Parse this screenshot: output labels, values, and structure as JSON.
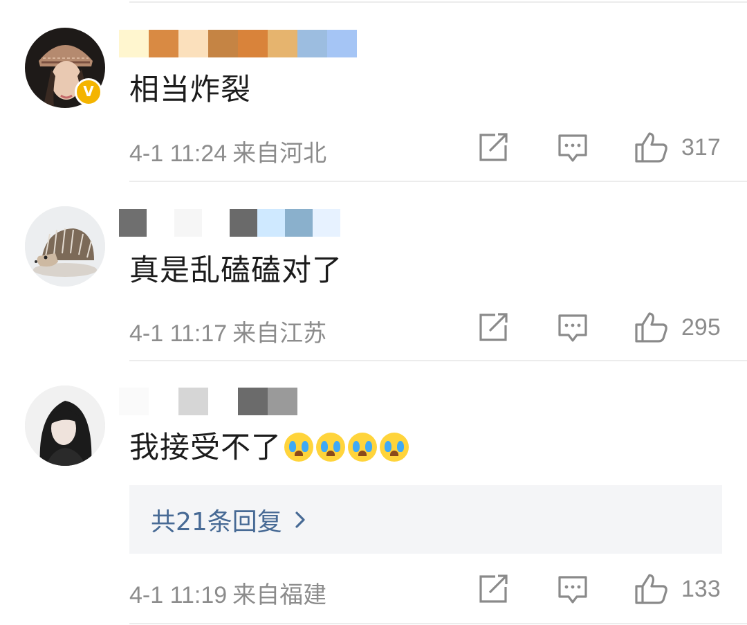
{
  "comments": [
    {
      "text": "相当炸裂",
      "time": "4-1 11:24",
      "location": "来自河北",
      "likes": "317",
      "verified": true,
      "verified_badge": "V",
      "avatar": "woman-in-knit-hat",
      "nickname_blur_colors": [
        "#fff6cf",
        "#d98a43",
        "#fbe0bc",
        "#c58444",
        "#d9833a",
        "#e6b46e",
        "#9cbde0",
        "#a5c5f5"
      ]
    },
    {
      "text": "真是乱磕磕对了",
      "time": "4-1 11:17",
      "location": "来自江苏",
      "likes": "295",
      "verified": false,
      "avatar": "hedgehog",
      "nickname_blur_colors": [
        "#6f6f6f",
        "#ffffff",
        "#f6f6f6",
        "#ffffff",
        "#6a6a6a",
        "#cfe9ff",
        "#8ab0cc",
        "#e7f2ff"
      ]
    },
    {
      "text": "我接受不了",
      "emoji_count": 4,
      "emoji": "crying-face",
      "time": "4-1 11:19",
      "location": "来自福建",
      "likes": "133",
      "verified": false,
      "avatar": "dark-haired-woman",
      "nickname_blur_colors": [
        "#fafafa",
        "#ffffff",
        "#d6d6d6",
        "#ffffff",
        "#6b6b6b",
        "#9a9a9a"
      ],
      "reply_summary": "共21条回复"
    }
  ],
  "icons": {
    "share": "share-icon",
    "comment": "comment-icon",
    "like": "thumbs-up-icon",
    "chevron": "chevron-right-icon"
  },
  "colors": {
    "meta_text": "#8c8c8c",
    "reply_link": "#476a95",
    "reply_bg": "#f4f5f7",
    "verified_badge": "#f4b400"
  }
}
